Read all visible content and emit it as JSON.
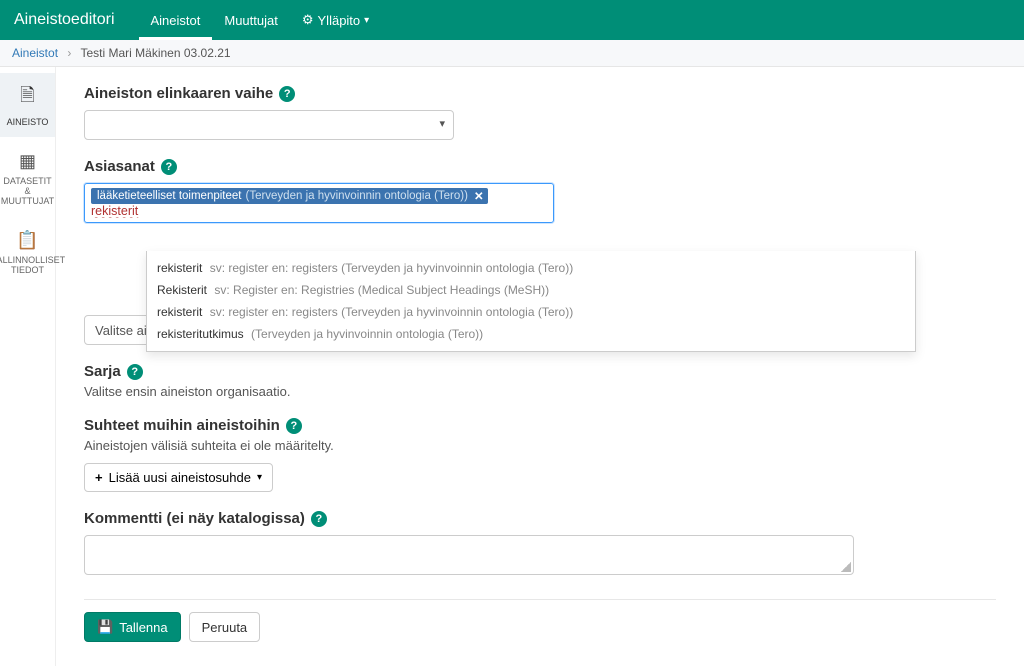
{
  "navbar": {
    "brand": "Aineistoeditori",
    "items": [
      "Aineistot",
      "Muuttujat",
      "Ylläpito"
    ]
  },
  "breadcrumbs": {
    "root": "Aineistot",
    "current": "Testi Mari Mäkinen 03.02.21"
  },
  "side_tabs": [
    {
      "icon_name": "document-icon",
      "glyph": "🗎",
      "label": "AINEISTO"
    },
    {
      "icon_name": "grid-icon",
      "glyph": "▦",
      "label": "DATASETIT & MUUTTUJAT"
    },
    {
      "icon_name": "clipboard-icon",
      "glyph": "📋",
      "label": "HALLINNOLLISET TIEDOT"
    }
  ],
  "labels": {
    "lifecycle": "Aineiston elinkaaren vaihe",
    "keywords": "Asiasanat",
    "type_placeholder": "Valitse aineistotyyppi",
    "series": "Sarja",
    "series_note": "Valitse ensin aineiston organisaatio.",
    "relations": "Suhteet muihin aineistoihin",
    "relations_note": "Aineistojen välisiä suhteita ei ole määritelty.",
    "add_relation": "Lisää uusi aineistosuhde",
    "comment": "Kommentti (ei näy katalogissa)",
    "save": "Tallenna",
    "cancel": "Peruuta"
  },
  "tag": {
    "label": "lääketieteelliset toimenpiteet",
    "source": "(Terveyden ja hyvinvoinnin ontologia (Tero))"
  },
  "tag_search_value": "rekisterit",
  "dropdown": [
    {
      "main": "rekisterit",
      "meta": "sv: register en: registers (Terveyden ja hyvinvoinnin ontologia (Tero))"
    },
    {
      "main": "Rekisterit",
      "meta": "sv: Register en: Registries (Medical Subject Headings (MeSH))"
    },
    {
      "main": "rekisterit",
      "meta": "sv: register en: registers (Terveyden ja hyvinvoinnin ontologia (Tero))"
    },
    {
      "main": "rekisteritutkimus",
      "meta": "(Terveyden ja hyvinvoinnin ontologia (Tero))"
    }
  ]
}
